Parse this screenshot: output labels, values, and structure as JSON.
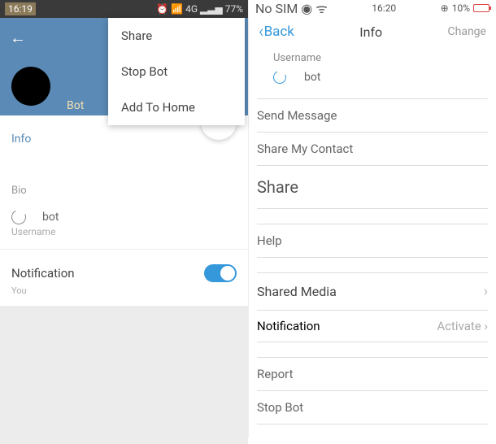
{
  "left": {
    "statusbar": {
      "time": "16:19",
      "signal": "4G",
      "battery_pct": "77%"
    },
    "header": {
      "bot_label": "Bot"
    },
    "dropdown": {
      "share": "Share",
      "stop_bot": "Stop Bot",
      "add_home": "Add To Home"
    },
    "info_label": "Info",
    "bio_label": "Bio",
    "at_bot": "bot",
    "username_label": "Username",
    "notification_label": "Notification",
    "notification_sub": "You"
  },
  "right": {
    "statusbar": {
      "no_sim": "No SIM",
      "time": "16:20",
      "battery_pct": "10%"
    },
    "header": {
      "back": "Back",
      "title": "Info",
      "change": "Change"
    },
    "username_label": "Username",
    "at_bot": "bot",
    "menu": {
      "send_message": "Send Message",
      "share_contact": "Share My Contact",
      "share": "Share",
      "help": "Help",
      "shared_media": "Shared Media",
      "notification": "Notification",
      "activate": "Activate",
      "report": "Report",
      "stop_bot": "Stop Bot"
    }
  }
}
